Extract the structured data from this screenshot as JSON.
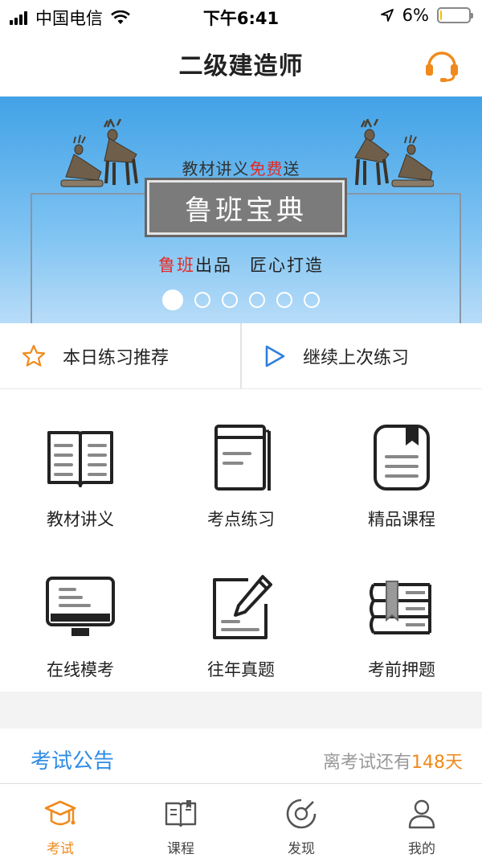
{
  "status_bar": {
    "carrier": "中国电信",
    "time": "下午6:41",
    "battery_percent": "6%",
    "battery_level": 0.06
  },
  "header": {
    "title": "二级建造师",
    "support_icon": "headset-icon"
  },
  "banner": {
    "tagline_prefix": "教材讲义",
    "tagline_highlight": "免费",
    "tagline_suffix": "送",
    "plate_text": "鲁班宝典",
    "slogan_red": "鲁班",
    "slogan_rest1": "出品",
    "slogan_rest2": "匠心打造",
    "dot_count": 6,
    "active_dot": 0
  },
  "quick": [
    {
      "label": "本日练习推荐",
      "icon": "star-icon"
    },
    {
      "label": "继续上次练习",
      "icon": "play-icon"
    }
  ],
  "grid": [
    {
      "label": "教材讲义",
      "icon": "book-icon"
    },
    {
      "label": "考点练习",
      "icon": "notebook-icon"
    },
    {
      "label": "精品课程",
      "icon": "bookmark-doc-icon"
    },
    {
      "label": "在线模考",
      "icon": "monitor-icon"
    },
    {
      "label": "往年真题",
      "icon": "edit-paper-icon"
    },
    {
      "label": "考前押题",
      "icon": "stacked-books-icon"
    }
  ],
  "notice": {
    "title": "考试公告",
    "countdown_prefix": "离考试还有",
    "countdown_days": "148天"
  },
  "tabs": [
    {
      "label": "考试",
      "icon": "graduation-cap-icon",
      "active": true
    },
    {
      "label": "课程",
      "icon": "open-book-icon",
      "active": false
    },
    {
      "label": "发现",
      "icon": "compass-icon",
      "active": false
    },
    {
      "label": "我的",
      "icon": "user-icon",
      "active": false
    }
  ],
  "colors": {
    "accent": "#f08a1c",
    "link_blue": "#2e8be6",
    "banner_red": "#e62822"
  }
}
